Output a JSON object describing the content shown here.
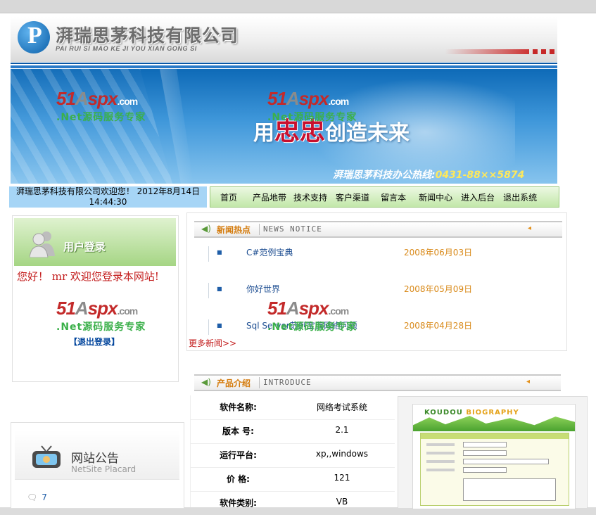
{
  "header": {
    "logo_letter": "P",
    "company_name": "湃瑞思茅科技有限公司",
    "company_pinyin": "PAI RUI SI MAO KE JI YOU XIAN GONG SI"
  },
  "banner": {
    "slogan_pre": "用",
    "slogan_red": "忠忠",
    "slogan_post": "创造未来",
    "hotline_label": "湃瑞思茅科技办公热线:",
    "hotline_number": "0431-88××5874"
  },
  "watermark": {
    "brand_main": "51",
    "brand_a": "A",
    "brand_rest": "spx",
    "brand_dom": ".com",
    "tagline": ".Net源码服务专家"
  },
  "welcome": {
    "line1": "湃瑞思茅科技有限公司欢迎您！ 2012年8月14日",
    "line2": "14:44:30"
  },
  "nav": {
    "items": [
      "首页",
      "产品地带",
      "技术支持",
      "客户渠道",
      "留言本",
      "新闻中心",
      "进入后台",
      "退出系统"
    ]
  },
  "login": {
    "title": "用户登录",
    "greeting": "您好！  mr 欢迎您登录本网站!",
    "logout": "【退出登录】"
  },
  "news": {
    "title_cn": "新闻热点",
    "title_en": "NEWS NOTICE",
    "items": [
      {
        "title": "C#范例宝典",
        "date": "2008年06月03日"
      },
      {
        "title": "你好世界",
        "date": "2008年05月09日"
      },
      {
        "title": "Sql Server范例宝典网络问题",
        "date": "2008年04月28日"
      }
    ],
    "more": "更多新闻>>"
  },
  "product": {
    "title_cn": "产品介绍",
    "title_en": "INTRODUCE",
    "rows": [
      {
        "label": "软件名称:",
        "value": "网络考试系统"
      },
      {
        "label": "版本 号:",
        "value": "2.1"
      },
      {
        "label": "运行平台:",
        "value": "xp,,windows"
      },
      {
        "label": "价  格:",
        "value": "121"
      },
      {
        "label": "软件类别:",
        "value": "VB"
      }
    ],
    "screenshot_title_a": "KOUDOU",
    "screenshot_title_b": "BIOGRAPHY"
  },
  "notice": {
    "title_cn": "网站公告",
    "title_en": "NetSite Placard",
    "item": "7"
  },
  "colors": {
    "brand_blue": "#0a58a6",
    "nav_green": "#c2e7a9",
    "welcome_blue": "#a6d5f6",
    "accent_orange": "#d47a0a",
    "link_red": "#c31c1c"
  }
}
